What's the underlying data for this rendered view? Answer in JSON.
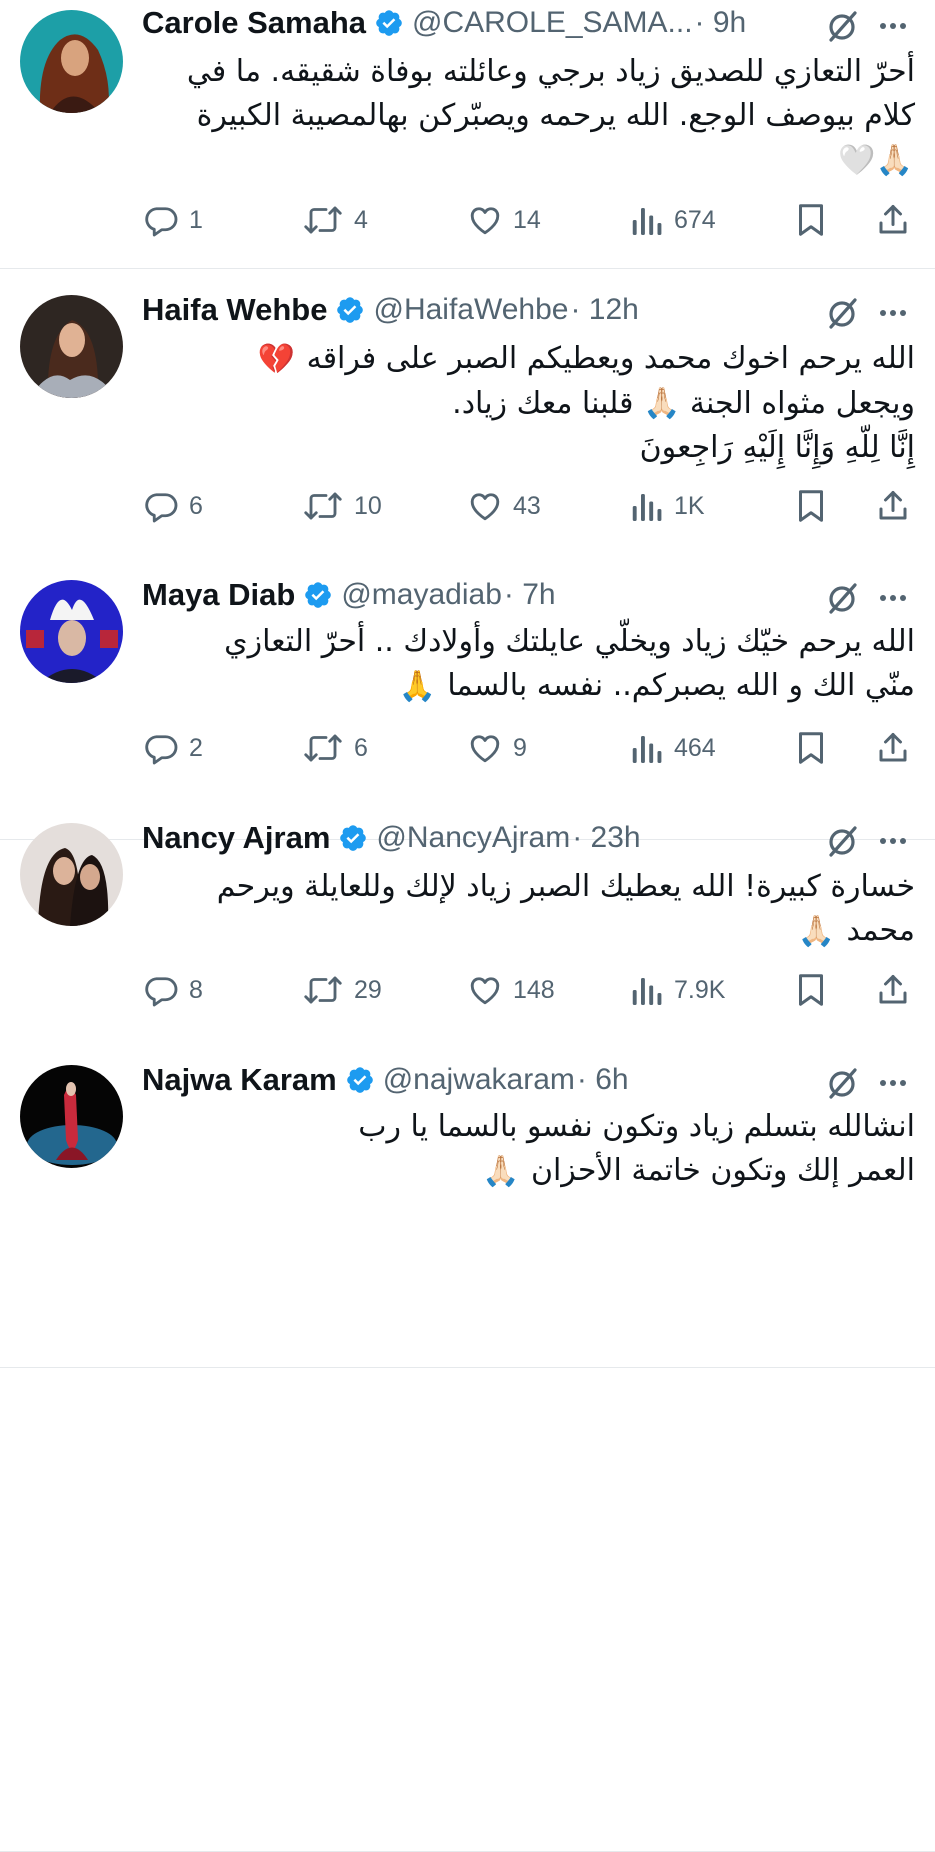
{
  "tweets": [
    {
      "name": "Carole Samaha",
      "handle": "@CAROLE_SAMA...",
      "time": "· 9h",
      "lines": [
        "أحرّ التعازي للصديق زياد برجي وعائلته بوفاة شقيقه. ما في",
        "كلام بيوصف الوجع. الله يرحمه ويصبّركن بهالمصيبة الكبيرة",
        ""
      ],
      "line_emojis": [
        "",
        "",
        "🙏🏻🤍"
      ],
      "replies": "1",
      "reposts": "4",
      "likes": "14",
      "views": "674"
    },
    {
      "name": "Haifa Wehbe",
      "handle": "@HaifaWehbe",
      "time": "· 12h",
      "lines": [
        "الله يرحم اخوك محمد ويعطيكم الصبر على فراقه",
        "ويجعل مثواه الجنة 🙏🏻 قلبنا معك زياد.",
        "إِنَّا لِلّهِ وَإِنَّا إِلَيْهِ رَاجِعونَ"
      ],
      "line_emojis": [
        "💔",
        "",
        ""
      ],
      "replies": "6",
      "reposts": "10",
      "likes": "43",
      "views": "1K"
    },
    {
      "name": "Maya Diab",
      "handle": "@mayadiab",
      "time": "· 7h",
      "lines": [
        "الله يرحم خيّك زياد ويخلّي عايلتك وأولادك .. أحرّ التعازي",
        "منّي الك و الله يصبركم.. نفسه بالسما"
      ],
      "line_emojis": [
        "",
        "🙏"
      ],
      "replies": "2",
      "reposts": "6",
      "likes": "9",
      "views": "464"
    },
    {
      "name": "Nancy Ajram",
      "handle": "@NancyAjram",
      "time": "· 23h",
      "lines": [
        "خسارة كبيرة! الله يعطيك الصبر زياد لإلك وللعايلة ويرحم",
        "محمد"
      ],
      "line_emojis": [
        "",
        "🙏🏻"
      ],
      "replies": "8",
      "reposts": "29",
      "likes": "148",
      "views": "7.9K"
    },
    {
      "name": "Najwa Karam",
      "handle": "@najwakaram",
      "time": "· 6h",
      "lines": [
        "انشالله بتسلم زياد وتكون نفسو بالسما يا رب",
        "العمر إلك وتكون خاتمة الأحزان"
      ],
      "line_emojis": [
        "",
        "🙏🏻"
      ]
    }
  ],
  "icons": {
    "reply": "reply-icon",
    "repost": "repost-icon",
    "like": "like-icon",
    "views": "views-icon",
    "bookmark": "bookmark-icon",
    "share": "share-icon",
    "grok": "grok-icon",
    "more": "more-icon",
    "verified": "verified-badge-icon"
  },
  "colors": {
    "verified": "#1d9bf0",
    "secondary": "#536471",
    "text": "#0f1419",
    "divider": "#e6e9ec"
  }
}
